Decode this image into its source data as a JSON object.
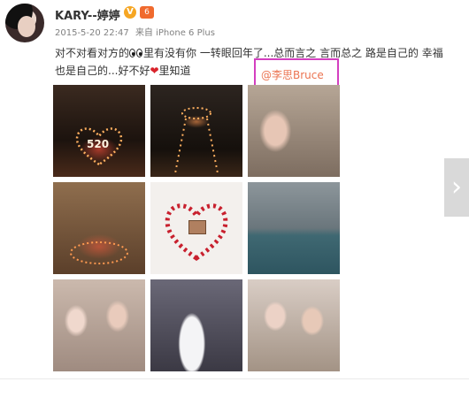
{
  "post": {
    "username": "KARY--婷婷",
    "verified_badge": "V",
    "level_badge": "6",
    "timestamp": "2015-5-20 22:47",
    "source": "来自 iPhone 6 Plus",
    "text_part1": "对不对看对方的",
    "text_part2": "里有没有你  一转眼回年了...总而言之 言而总之 路是自己的  幸福也是自己的...好不好",
    "text_part3": "里知道",
    "mention": "@李思Bruce",
    "photos": [
      {
        "alt": "candle heart 520 photo 1"
      },
      {
        "alt": "candle path photo 2"
      },
      {
        "alt": "couple photo 3"
      },
      {
        "alt": "room candles photo 4"
      },
      {
        "alt": "rose petal heart photo 5"
      },
      {
        "alt": "sea view photo 6"
      },
      {
        "alt": "selfie photo 7"
      },
      {
        "alt": "wedding photo 8"
      },
      {
        "alt": "selfie photo 9"
      }
    ],
    "photo1_label": "520",
    "next_glyph": "›"
  }
}
